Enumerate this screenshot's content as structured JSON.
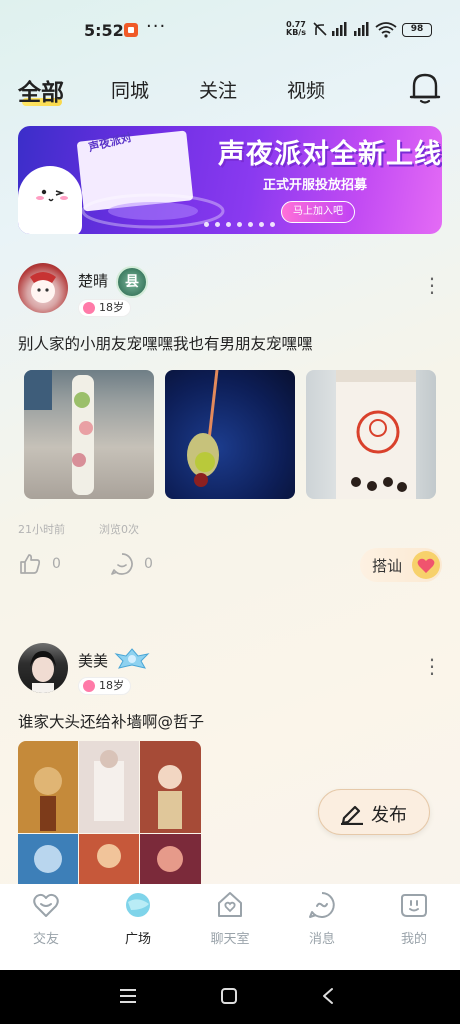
{
  "status_bar": {
    "time": "5:52",
    "more": "···",
    "speed_value": "0.77",
    "speed_unit": "KB/s",
    "battery": "98"
  },
  "tabs": [
    {
      "label": "全部",
      "active": true
    },
    {
      "label": "同城",
      "active": false
    },
    {
      "label": "关注",
      "active": false
    },
    {
      "label": "视频",
      "active": false
    }
  ],
  "banner": {
    "title": "声夜派对全新上线",
    "subtitle": "正式开服投放招募",
    "button": "马上加入吧",
    "paper_text": "声夜派对",
    "dot_count": 7
  },
  "posts": [
    {
      "username": "楚晴",
      "age": "18岁",
      "text": "别人家的小朋友宠嘿嘿我也有男朋友宠嘿嘿",
      "time_ago": "21小时前",
      "views": "浏览0次",
      "likes": "0",
      "comments": "0",
      "chat_button": "搭讪",
      "level_badge": "县"
    },
    {
      "username": "美美",
      "age": "18岁",
      "text": "谁家大头还给补墙啊@哲子"
    }
  ],
  "publish_button": "发布",
  "bottom_nav": [
    {
      "label": "交友",
      "icon": "heart-icon",
      "active": false
    },
    {
      "label": "广场",
      "icon": "plaza-icon",
      "active": true
    },
    {
      "label": "聊天室",
      "icon": "house-heart-icon",
      "active": false
    },
    {
      "label": "消息",
      "icon": "message-icon",
      "active": false
    },
    {
      "label": "我的",
      "icon": "profile-icon",
      "active": false
    }
  ],
  "colors": {
    "banner_start": "#3b2ec9",
    "banner_end": "#e46bf5",
    "nav_inactive": "#9aa3aa",
    "publish_bg": "#fbeee0"
  }
}
